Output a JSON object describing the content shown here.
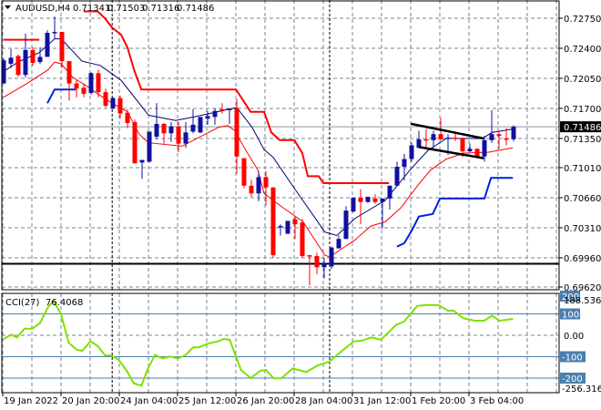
{
  "header": {
    "symbol": "AUDUSD,H4",
    "open": "0.71341",
    "high": "0.71503",
    "low": "0.71316",
    "close": "0.71486"
  },
  "colors": {
    "bull": "#1010a0",
    "bear": "#ff0000",
    "ma_fast": "#00006e",
    "ma_slow": "#ff0000",
    "upper_band": "#ff0000",
    "lower_band": "#0020e0",
    "cci": "#80e000",
    "level": "#4a7fb0",
    "grid": "#7a8593"
  },
  "price_axis": {
    "ticks": [
      "0.72750",
      "0.72400",
      "0.72050",
      "0.71700",
      "0.71350",
      "0.71010",
      "0.70660",
      "0.70310",
      "0.69960",
      "0.69620"
    ],
    "tick_values": [
      0.7275,
      0.724,
      0.7205,
      0.717,
      0.7135,
      0.7101,
      0.7066,
      0.7031,
      0.6996,
      0.6962
    ],
    "current_label": "0.71486",
    "current_value": 0.71486
  },
  "time_axis": {
    "labels": [
      "19 Jan 2022",
      "20 Jan 20:00",
      "24 Jan 04:00",
      "25 Jan 12:00",
      "26 Jan 20:00",
      "28 Jan 04:00",
      "31 Jan 12:00",
      "1 Feb 20:00",
      "3 Feb 04:00"
    ]
  },
  "chart_data": [
    {
      "type": "candlestick",
      "title": "AUDUSD,H4",
      "ylim": [
        0.6958,
        0.7295
      ],
      "ohlc": [
        [
          0.7199,
          0.7228,
          0.7199,
          0.7226
        ],
        [
          0.7222,
          0.7239,
          0.7217,
          0.7229
        ],
        [
          0.7231,
          0.7233,
          0.7207,
          0.7209
        ],
        [
          0.7209,
          0.7257,
          0.7206,
          0.7238
        ],
        [
          0.7238,
          0.7241,
          0.722,
          0.7223
        ],
        [
          0.7224,
          0.7241,
          0.7222,
          0.723
        ],
        [
          0.723,
          0.7261,
          0.723,
          0.7258
        ],
        [
          0.7258,
          0.7277,
          0.7251,
          0.7259
        ],
        [
          0.7259,
          0.7259,
          0.7217,
          0.7225
        ],
        [
          0.7225,
          0.7225,
          0.7179,
          0.7199
        ],
        [
          0.7199,
          0.7203,
          0.7183,
          0.7193
        ],
        [
          0.7194,
          0.7199,
          0.7183,
          0.7187
        ],
        [
          0.7188,
          0.7212,
          0.7186,
          0.7211
        ],
        [
          0.7211,
          0.7215,
          0.7183,
          0.7189
        ],
        [
          0.7189,
          0.7193,
          0.7171,
          0.7173
        ],
        [
          0.717,
          0.7183,
          0.7169,
          0.7182
        ],
        [
          0.7182,
          0.7185,
          0.7158,
          0.7164
        ],
        [
          0.7165,
          0.7169,
          0.7147,
          0.7153
        ],
        [
          0.7154,
          0.7157,
          0.7106,
          0.7106
        ],
        [
          0.7107,
          0.711,
          0.7088,
          0.711
        ],
        [
          0.7108,
          0.7143,
          0.7107,
          0.7143
        ],
        [
          0.7137,
          0.7176,
          0.7134,
          0.7152
        ],
        [
          0.7152,
          0.7153,
          0.7129,
          0.7141
        ],
        [
          0.7141,
          0.7154,
          0.7131,
          0.7149
        ],
        [
          0.7149,
          0.7154,
          0.7119,
          0.7129
        ],
        [
          0.7129,
          0.7154,
          0.7124,
          0.7142
        ],
        [
          0.7143,
          0.7169,
          0.7141,
          0.7151
        ],
        [
          0.7142,
          0.716,
          0.7141,
          0.716
        ],
        [
          0.7158,
          0.7167,
          0.7151,
          0.7161
        ],
        [
          0.716,
          0.717,
          0.7151,
          0.7167
        ],
        [
          0.7169,
          0.7176,
          0.7164,
          0.7167
        ],
        [
          0.7168,
          0.717,
          0.7152,
          0.717
        ],
        [
          0.717,
          0.7181,
          0.7094,
          0.7114
        ],
        [
          0.7112,
          0.7112,
          0.7077,
          0.708
        ],
        [
          0.708,
          0.7087,
          0.7067,
          0.7071
        ],
        [
          0.7071,
          0.7097,
          0.7062,
          0.709
        ],
        [
          0.709,
          0.7097,
          0.7057,
          0.7078
        ],
        [
          0.7078,
          0.7078,
          0.6996,
          0.6999
        ],
        [
          0.7032,
          0.7035,
          0.7022,
          0.7033
        ],
        [
          0.7024,
          0.7039,
          0.7024,
          0.7039
        ],
        [
          0.7041,
          0.7044,
          0.7018,
          0.7035
        ],
        [
          0.7037,
          0.7041,
          0.6996,
          0.6998
        ],
        [
          0.6999,
          0.6999,
          0.6964,
          0.6998
        ],
        [
          0.6998,
          0.7002,
          0.6977,
          0.6985
        ],
        [
          0.6985,
          0.6996,
          0.6972,
          0.699
        ],
        [
          0.6986,
          0.7009,
          0.6983,
          0.7008
        ],
        [
          0.7007,
          0.7022,
          0.7007,
          0.7018
        ],
        [
          0.7018,
          0.7056,
          0.7018,
          0.7051
        ],
        [
          0.705,
          0.7066,
          0.7049,
          0.7066
        ],
        [
          0.7066,
          0.7076,
          0.7035,
          0.7061
        ],
        [
          0.7061,
          0.7067,
          0.706,
          0.7067
        ],
        [
          0.7065,
          0.707,
          0.7059,
          0.7061
        ],
        [
          0.7061,
          0.7065,
          0.703,
          0.7065
        ],
        [
          0.7065,
          0.708,
          0.7052,
          0.708
        ],
        [
          0.708,
          0.7108,
          0.708,
          0.7102
        ],
        [
          0.7102,
          0.7117,
          0.7086,
          0.7111
        ],
        [
          0.7111,
          0.713,
          0.7108,
          0.7127
        ],
        [
          0.7124,
          0.7144,
          0.7124,
          0.7134
        ],
        [
          0.7134,
          0.7146,
          0.7124,
          0.7133
        ],
        [
          0.7133,
          0.7144,
          0.7124,
          0.714
        ],
        [
          0.714,
          0.7159,
          0.7133,
          0.7134
        ],
        [
          0.7135,
          0.714,
          0.7116,
          0.7136
        ],
        [
          0.7136,
          0.7143,
          0.7132,
          0.7135
        ],
        [
          0.7135,
          0.7136,
          0.7113,
          0.712
        ],
        [
          0.712,
          0.7129,
          0.7119,
          0.7123
        ],
        [
          0.7123,
          0.7123,
          0.7113,
          0.7114
        ],
        [
          0.7114,
          0.7138,
          0.7108,
          0.7133
        ],
        [
          0.7133,
          0.7168,
          0.713,
          0.714
        ],
        [
          0.714,
          0.7144,
          0.7123,
          0.7138
        ],
        [
          0.7135,
          0.7147,
          0.7127,
          0.7134
        ],
        [
          0.71341,
          0.71503,
          0.71316,
          0.71486
        ]
      ],
      "ma_fast": [
        [
          0,
          0.7213
        ],
        [
          2,
          0.7224
        ],
        [
          4.9,
          0.7235
        ],
        [
          7,
          0.7251
        ],
        [
          7.9,
          0.7251
        ],
        [
          10.75,
          0.7225
        ],
        [
          13.25,
          0.722
        ],
        [
          16.1,
          0.7203
        ],
        [
          19.9,
          0.7162
        ],
        [
          23.6,
          0.7156
        ],
        [
          26.1,
          0.716
        ],
        [
          32,
          0.7171
        ],
        [
          34.1,
          0.7148
        ],
        [
          35.75,
          0.7122
        ],
        [
          37,
          0.7113
        ],
        [
          39.9,
          0.7077
        ],
        [
          44.1,
          0.7026
        ],
        [
          45.75,
          0.7022
        ],
        [
          48.25,
          0.7042
        ],
        [
          52.4,
          0.7063
        ],
        [
          55.75,
          0.7098
        ],
        [
          58.25,
          0.7121
        ],
        [
          60.75,
          0.7135
        ],
        [
          65.75,
          0.7135
        ],
        [
          67,
          0.7142
        ],
        [
          69.9,
          0.7146
        ]
      ],
      "ma_slow": [
        [
          0,
          0.7183
        ],
        [
          2,
          0.7193
        ],
        [
          3.6,
          0.7201
        ],
        [
          6.1,
          0.7215
        ],
        [
          7,
          0.7224
        ],
        [
          7.9,
          0.7222
        ],
        [
          9.5,
          0.7206
        ],
        [
          11.6,
          0.7195
        ],
        [
          12.9,
          0.7187
        ],
        [
          14.9,
          0.7176
        ],
        [
          17,
          0.7166
        ],
        [
          18.6,
          0.714
        ],
        [
          19.9,
          0.713
        ],
        [
          24.5,
          0.7126
        ],
        [
          29.5,
          0.7148
        ],
        [
          30.75,
          0.715
        ],
        [
          31.75,
          0.7144
        ],
        [
          32.9,
          0.7126
        ],
        [
          34.9,
          0.7098
        ],
        [
          35.75,
          0.7071
        ],
        [
          38.25,
          0.7055
        ],
        [
          41.1,
          0.7038
        ],
        [
          44.1,
          0.6999
        ],
        [
          44.75,
          0.6997
        ],
        [
          48.25,
          0.7017
        ],
        [
          50.4,
          0.7033
        ],
        [
          52.4,
          0.7038
        ],
        [
          54.5,
          0.7054
        ],
        [
          57,
          0.7082
        ],
        [
          58.6,
          0.7098
        ],
        [
          60.75,
          0.7111
        ],
        [
          63.25,
          0.7118
        ],
        [
          66.6,
          0.7119
        ],
        [
          69.9,
          0.7124
        ]
      ],
      "upper_band": [
        [
          [
            0,
            0.725
          ],
          [
            4.9,
            0.725
          ]
        ],
        [
          [
            11,
            0.7283
          ],
          [
            12.9,
            0.7283
          ],
          [
            13.9,
            0.7275
          ],
          [
            14.9,
            0.7264
          ],
          [
            16.1,
            0.7256
          ],
          [
            17,
            0.7241
          ],
          [
            17.9,
            0.7215
          ],
          [
            18.9,
            0.7192
          ],
          [
            31.9,
            0.7192
          ],
          [
            33.9,
            0.7166
          ],
          [
            35.75,
            0.7166
          ],
          [
            36.75,
            0.7142
          ],
          [
            37.9,
            0.7133
          ],
          [
            39.9,
            0.7133
          ],
          [
            41,
            0.7118
          ],
          [
            41.75,
            0.7091
          ],
          [
            43.25,
            0.7091
          ],
          [
            43.9,
            0.7083
          ],
          [
            52.9,
            0.7083
          ]
        ]
      ],
      "lower_band": [
        [
          [
            6,
            0.7176
          ],
          [
            7,
            0.7192
          ],
          [
            9.9,
            0.7192
          ]
        ],
        [
          [
            54,
            0.7009
          ],
          [
            55,
            0.7013
          ],
          [
            56.1,
            0.7029
          ],
          [
            57,
            0.7044
          ],
          [
            58.9,
            0.7047
          ],
          [
            59.9,
            0.7065
          ],
          [
            66,
            0.7065
          ],
          [
            66.9,
            0.7089
          ],
          [
            69.9,
            0.7089
          ]
        ]
      ],
      "trendlines": [
        [
          [
            55.9,
            0.7152
          ],
          [
            65.9,
            0.7135
          ]
        ],
        [
          [
            57,
            0.7125
          ],
          [
            65.9,
            0.7112
          ]
        ]
      ],
      "support_level": 0.6989,
      "period_separators": [
        14.9,
        44.75
      ]
    },
    {
      "type": "line",
      "title": "CCI(27)",
      "last_value": "76.4068",
      "ylim": [
        -256.3168,
        188.5366
      ],
      "max_label": "188.5366",
      "min_label": "-256.3168",
      "levels": [
        {
          "value": 200,
          "label": "200"
        },
        {
          "value": 100,
          "label": "100"
        },
        {
          "value": -100,
          "label": "-100"
        },
        {
          "value": -200,
          "label": "-200"
        }
      ],
      "zero_label": "0.00",
      "points": [
        [
          0,
          -18
        ],
        [
          1.04,
          3
        ],
        [
          1.83,
          -10
        ],
        [
          2.88,
          31
        ],
        [
          3.93,
          31
        ],
        [
          4.98,
          56
        ],
        [
          6.03,
          127
        ],
        [
          6.82,
          162
        ],
        [
          7.88,
          99
        ],
        [
          8.93,
          -35
        ],
        [
          9.98,
          -66
        ],
        [
          10.77,
          -73
        ],
        [
          11.92,
          -28
        ],
        [
          12.87,
          -49
        ],
        [
          13.92,
          -94
        ],
        [
          14.71,
          -94
        ],
        [
          15.76,
          -113
        ],
        [
          16.82,
          -162
        ],
        [
          17.87,
          -225
        ],
        [
          18.92,
          -235
        ],
        [
          19.71,
          -162
        ],
        [
          20.76,
          -92
        ],
        [
          21.81,
          -108
        ],
        [
          22.86,
          -99
        ],
        [
          23.92,
          -108
        ],
        [
          24.97,
          -92
        ],
        [
          26.02,
          -56
        ],
        [
          26.81,
          -56
        ],
        [
          28.12,
          -38
        ],
        [
          29.44,
          -28
        ],
        [
          30.23,
          -17
        ],
        [
          31.02,
          -21
        ],
        [
          32.59,
          -162
        ],
        [
          33.91,
          -200
        ],
        [
          35.22,
          -166
        ],
        [
          36.01,
          -162
        ],
        [
          37.06,
          -201
        ],
        [
          38.11,
          -201
        ],
        [
          39.69,
          -155
        ],
        [
          41.53,
          -172
        ],
        [
          43.11,
          -141
        ],
        [
          44.69,
          -124
        ],
        [
          46.79,
          -63
        ],
        [
          48.11,
          -28
        ],
        [
          49.16,
          -25
        ],
        [
          50.47,
          -10
        ],
        [
          51.79,
          -21
        ],
        [
          53.89,
          49
        ],
        [
          54.94,
          63
        ],
        [
          56.78,
          137
        ],
        [
          57.84,
          141
        ],
        [
          59.68,
          141
        ],
        [
          60.99,
          115
        ],
        [
          61.78,
          115
        ],
        [
          63.09,
          80
        ],
        [
          64.67,
          68
        ],
        [
          65.98,
          68
        ],
        [
          67.03,
          92
        ],
        [
          68.08,
          68
        ],
        [
          69.92,
          76.4
        ]
      ]
    }
  ]
}
